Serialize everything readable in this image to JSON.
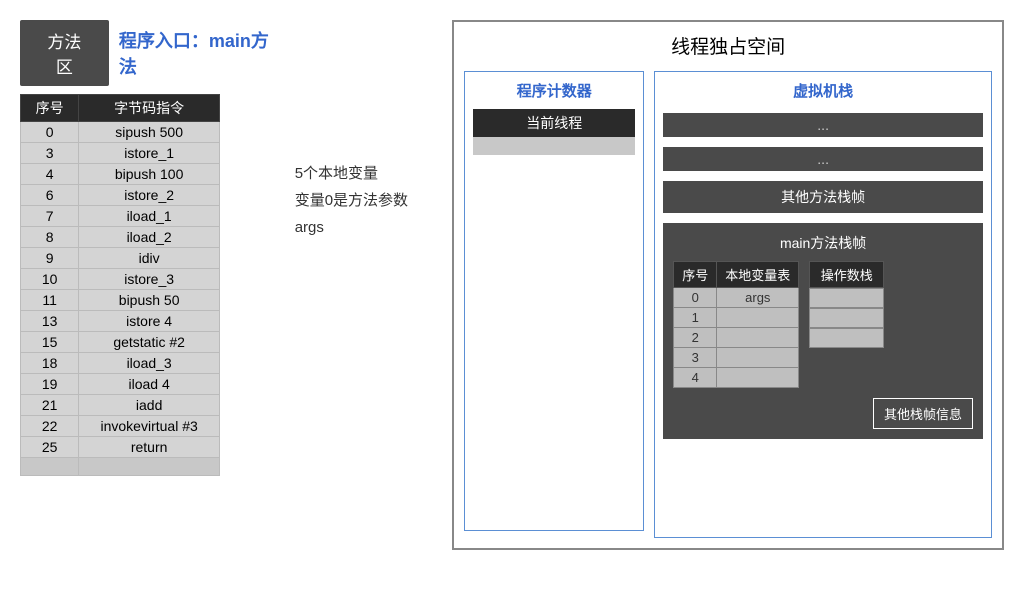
{
  "methodArea": {
    "label": "方法区"
  },
  "entry": {
    "label": "程序入口：main方法"
  },
  "bytecode": {
    "headers": {
      "seq": "序号",
      "instr": "字节码指令"
    },
    "rows": [
      {
        "seq": "0",
        "instr": "sipush 500"
      },
      {
        "seq": "3",
        "instr": "istore_1"
      },
      {
        "seq": "4",
        "instr": "bipush 100"
      },
      {
        "seq": "6",
        "instr": "istore_2"
      },
      {
        "seq": "7",
        "instr": "iload_1"
      },
      {
        "seq": "8",
        "instr": "iload_2"
      },
      {
        "seq": "9",
        "instr": "idiv"
      },
      {
        "seq": "10",
        "instr": "istore_3"
      },
      {
        "seq": "11",
        "instr": "bipush 50"
      },
      {
        "seq": "13",
        "instr": "istore 4"
      },
      {
        "seq": "15",
        "instr": "getstatic #2"
      },
      {
        "seq": "18",
        "instr": "iload_3"
      },
      {
        "seq": "19",
        "instr": "iload 4"
      },
      {
        "seq": "21",
        "instr": "iadd"
      },
      {
        "seq": "22",
        "instr": "invokevirtual #3"
      },
      {
        "seq": "25",
        "instr": "return"
      }
    ]
  },
  "sideNote": {
    "line1": "5个本地变量",
    "line2": "变量0是方法参数args"
  },
  "threadSpace": {
    "title": "线程独占空间",
    "pcCounter": {
      "title": "程序计数器",
      "current": "当前线程"
    },
    "vmStack": {
      "title": "虚拟机栈",
      "ellipsis1": "...",
      "ellipsis2": "...",
      "otherFrame": "其他方法栈帧",
      "mainFrame": {
        "title": "main方法栈帧",
        "localVarHeaders": {
          "seq": "序号",
          "name": "本地变量表"
        },
        "localVars": [
          {
            "seq": "0",
            "name": "args"
          },
          {
            "seq": "1",
            "name": ""
          },
          {
            "seq": "2",
            "name": ""
          },
          {
            "seq": "3",
            "name": ""
          },
          {
            "seq": "4",
            "name": ""
          }
        ],
        "opStack": {
          "header": "操作数栈"
        },
        "otherInfo": "其他栈帧信息"
      }
    }
  }
}
